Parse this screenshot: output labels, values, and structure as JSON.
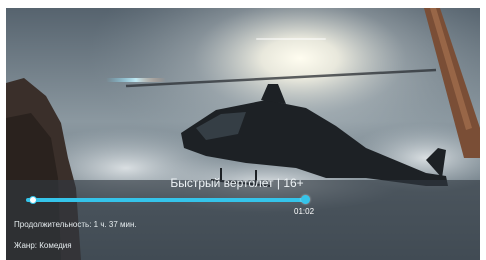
{
  "player": {
    "title": "Быстрый вертолет | 16+",
    "current_time": "01:02",
    "progress": 0.64,
    "duration_text": "Продолжительность: 1 ч. 37 мин.",
    "genre_text": "Жанр: Комедия",
    "accent_color": "#35c4ea",
    "background_image": "helicopter-in-flight-photo"
  }
}
